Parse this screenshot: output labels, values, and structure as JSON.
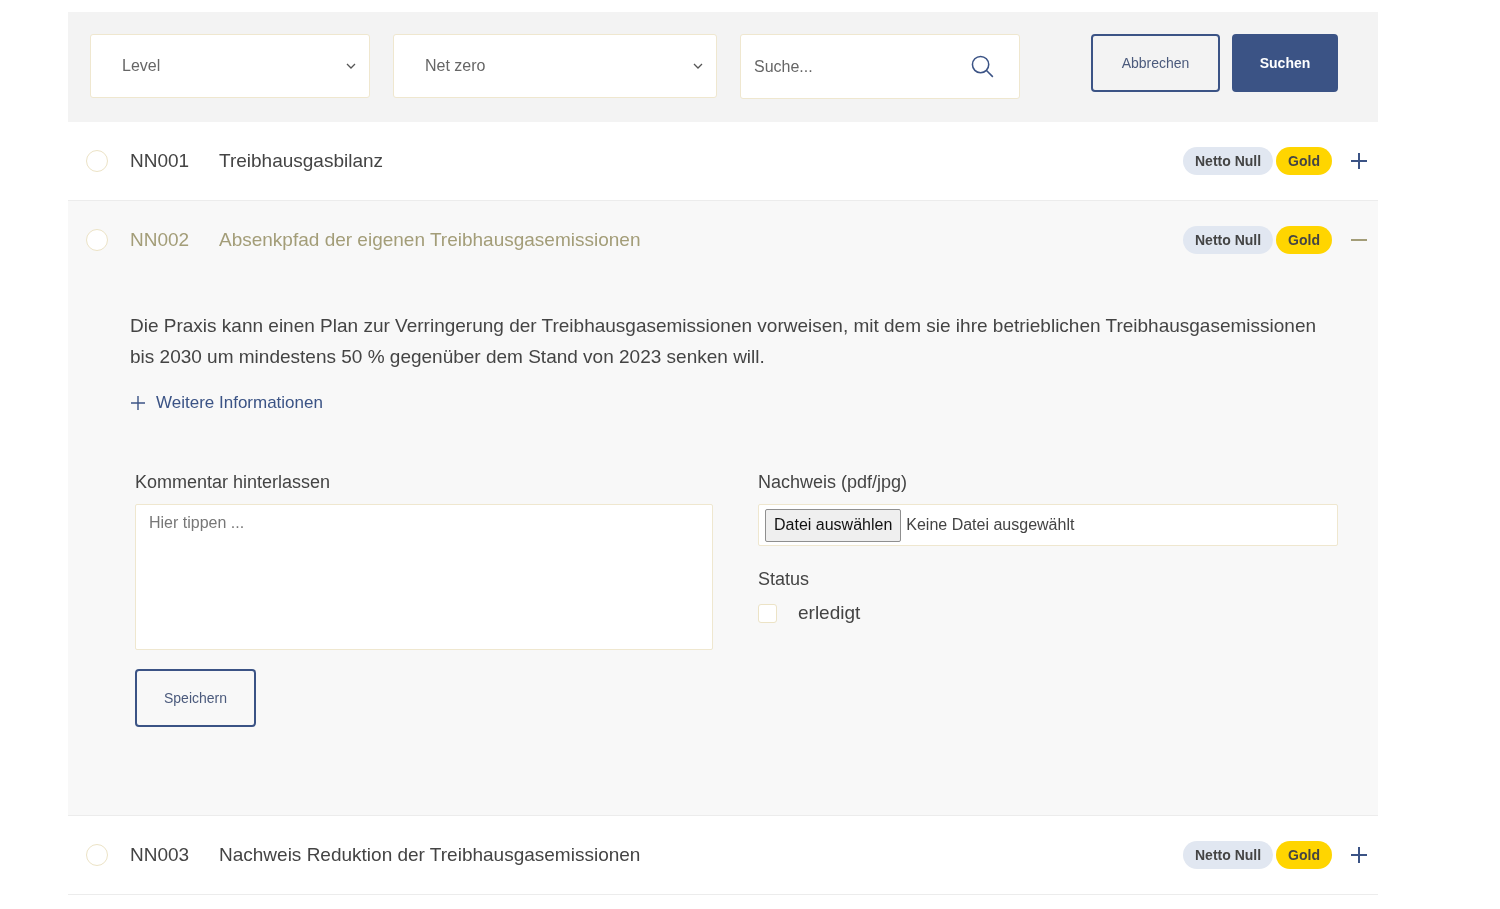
{
  "filters": {
    "dropdowns": [
      {
        "value": "Level"
      },
      {
        "value": "Net zero"
      }
    ],
    "search": {
      "placeholder": "Suche..."
    },
    "buttons": [
      {
        "label": "Abbrechen",
        "kind": "secondary"
      },
      {
        "label": "Suchen",
        "kind": "primary"
      }
    ]
  },
  "items": [
    {
      "code": "NN001",
      "title": "Treibhausgasbilanz",
      "checked": false,
      "expanded": false,
      "tags": [
        {
          "label": "Netto Null",
          "color": "#e1e7f1"
        },
        {
          "label": "Gold",
          "color": "#ffd500"
        }
      ]
    },
    {
      "code": "NN002",
      "title": "Absenkpfad der eigenen Treibhausgasemissionen",
      "checked": false,
      "expanded": true,
      "tags": [
        {
          "label": "Netto Null",
          "color": "#e1e7f1"
        },
        {
          "label": "Gold",
          "color": "#ffd500"
        }
      ],
      "details": {
        "description": "Die Praxis kann einen Plan zur Verringerung der Treibhausgasemissionen vorweisen, mit dem sie ihre betrieblichen Treibhausgasemissionen bis 2030 um mindestens 50 % gegenüber dem Stand von 2023 senken will.",
        "more_info": "Weitere Informationen",
        "comment": {
          "label": "Kommentar hinterlassen",
          "placeholder": "Hier tippen ..."
        },
        "save_button": "Speichern",
        "evidence": {
          "label": "Nachweis (pdf/jpg)",
          "button": "Datei auswählen",
          "file_status": "Keine Datei ausgewählt"
        },
        "status": {
          "label": "Status",
          "checkbox": {
            "label": "erledigt",
            "checked": false
          }
        }
      }
    },
    {
      "code": "NN003",
      "title": "Nachweis Reduktion der Treibhausgasemissionen",
      "checked": false,
      "expanded": false,
      "tags": [
        {
          "label": "Netto Null",
          "color": "#e1e7f1"
        },
        {
          "label": "Gold",
          "color": "#ffd500"
        }
      ]
    }
  ]
}
